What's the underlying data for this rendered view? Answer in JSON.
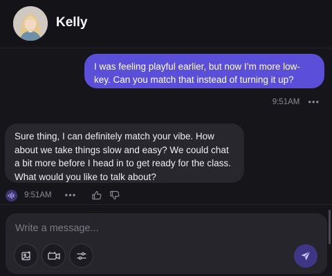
{
  "header": {
    "contact_name": "Kelly",
    "avatar_icon": "user-avatar"
  },
  "messages": [
    {
      "direction": "outgoing",
      "text": "I was feeling playful earlier, but now I’m more low-key. Can you match that instead of turning it up?",
      "time": "9:51AM",
      "more_icon": "more-dots-icon"
    },
    {
      "direction": "incoming",
      "text": "Sure thing, I can definitely match your vibe. How about we take things slow and easy? We could chat a bit more before I head in to get ready for the class. What would you like to talk about?",
      "time": "9:51AM",
      "icons": [
        "voice-play-icon",
        "more-dots-icon",
        "thumbs-up-icon",
        "thumbs-down-icon"
      ]
    }
  ],
  "composer": {
    "placeholder": "Write a message...",
    "value": "",
    "tools": [
      "image-icon",
      "video-icon",
      "sliders-icon"
    ],
    "send_icon": "send-icon"
  },
  "colors": {
    "accent": "#5b4fd9",
    "background": "#161519",
    "incoming_bubble": "#28272d",
    "composer": "#26252b",
    "send_button": "#3f3786"
  }
}
